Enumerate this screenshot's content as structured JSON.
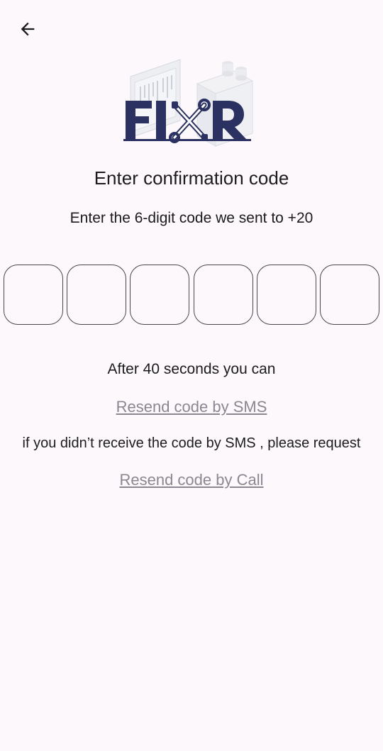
{
  "header": {
    "back_icon": "arrow-left-icon"
  },
  "logo": {
    "text": "FIXR",
    "colors": {
      "brand": "#2b3160",
      "tool": "#2b3160",
      "illustration": "#d9dbe2"
    }
  },
  "main": {
    "title": "Enter confirmation code",
    "subtitle": "Enter the 6-digit code we sent to +20",
    "code_inputs": [
      "",
      "",
      "",
      "",
      "",
      ""
    ],
    "timer_text": "After 40 seconds you can",
    "resend_sms_label": "Resend code by SMS",
    "hint_text": "if you didn’t receive the code by SMS , please request",
    "resend_call_label": "Resend code by Call"
  },
  "colors": {
    "background": "#fdf8fc",
    "text": "#1c1b1f",
    "link": "#8a8790",
    "input_border": "#49454f"
  }
}
